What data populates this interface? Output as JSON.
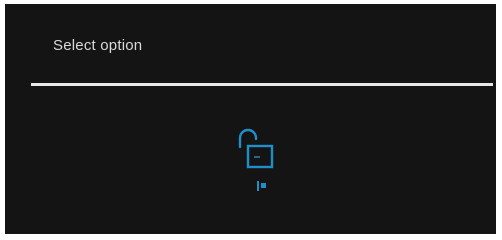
{
  "dialog": {
    "title": "Select option",
    "accent_color": "#1f8ec9",
    "options": [
      {
        "icon": "unlocked-padlock-icon",
        "label": ""
      }
    ]
  }
}
